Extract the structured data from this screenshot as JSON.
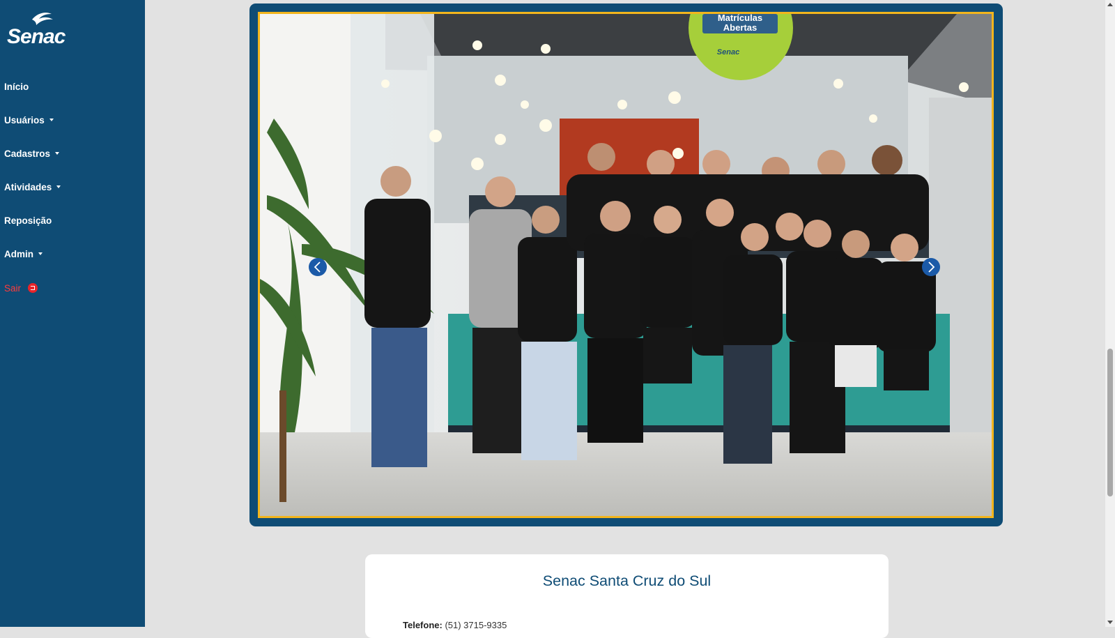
{
  "sidebar": {
    "logo_text": "Senac",
    "items": [
      {
        "label": "Início",
        "has_caret": false
      },
      {
        "label": "Usuários",
        "has_caret": true
      },
      {
        "label": "Cadastros",
        "has_caret": true
      },
      {
        "label": "Atividades",
        "has_caret": true
      },
      {
        "label": "Reposição",
        "has_caret": false
      },
      {
        "label": "Admin",
        "has_caret": true
      }
    ],
    "logout_label": "Sair",
    "logout_icon": "logout-icon"
  },
  "carousel": {
    "sign_text_1": "Matrículas",
    "sign_text_2": "Abertas",
    "sign_brand": "Senac",
    "prev_icon": "chevron-left-icon",
    "next_icon": "chevron-right-icon"
  },
  "info_card": {
    "title": "Senac Santa Cruz do Sul",
    "phone_label": "Telefone:",
    "phone_value": "(51) 3715-9335"
  },
  "colors": {
    "sidebar_bg": "#0f4c75",
    "accent_gold": "#f2b51d",
    "logout_red": "#e8242a",
    "page_bg": "#e2e2e2"
  }
}
